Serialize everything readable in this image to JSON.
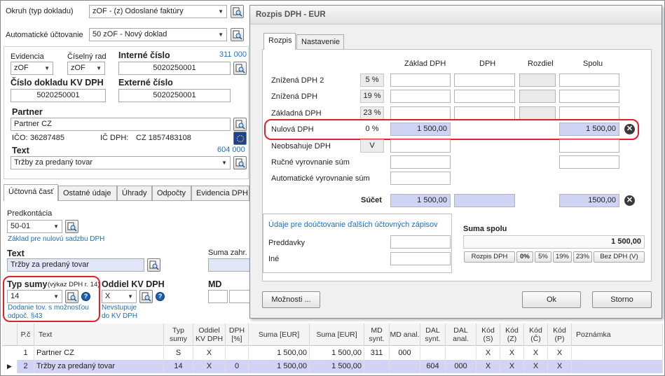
{
  "left": {
    "okruh": {
      "label": "Okruh (typ dokladu)",
      "value": "zOF - (z) Odoslané faktúry"
    },
    "auto": {
      "label": "Automatické účtovanie",
      "value": "50 zOF - Nový doklad"
    },
    "evidencia": {
      "label": "Evidencia",
      "value": "zOF"
    },
    "ciselny": {
      "label": "Číselný rad",
      "value": "zOF"
    },
    "interne": {
      "label": "Interné číslo",
      "value": "5020250001",
      "counter": "311 000"
    },
    "kvdph": {
      "label": "Číslo dokladu KV DPH",
      "value": "5020250001"
    },
    "externe": {
      "label": "Externé číslo",
      "value": "5020250001"
    },
    "partner": {
      "label": "Partner",
      "value": "Partner CZ",
      "ico_label": "IČO:",
      "ico": "36287485",
      "icdph_label": "IČ DPH:",
      "icdph": "CZ 1857483108"
    },
    "text": {
      "label": "Text",
      "value": "Tržby za predaný tovar",
      "counter": "604 000"
    },
    "tabs": [
      "Účtovná časť",
      "Ostatné údaje",
      "Úhrady",
      "Odpočty",
      "Evidencia DPH"
    ],
    "predkontacia": {
      "label": "Predkontácia",
      "value": "50-01",
      "hint": "Základ pre nulovú sadzbu DPH"
    },
    "text2": {
      "label": "Text",
      "value": "Tržby za predaný tovar"
    },
    "suma_zahr": "Suma zahr.",
    "typ_sumy": {
      "label": "Typ sumy",
      "sub": "(výkaz DPH r. 14)",
      "value": "14",
      "hint1": "Dodanie tov. s možnosťou",
      "hint2": "odpoč. §43"
    },
    "oddiel": {
      "label": "Oddiel KV DPH",
      "value": "X",
      "hint1": "Nevstupuje",
      "hint2": "do KV DPH"
    },
    "md": "MD"
  },
  "dialog": {
    "title": "Rozpis DPH - EUR",
    "tabs": [
      "Rozpis",
      "Nastavenie"
    ],
    "headers": [
      "Základ DPH",
      "DPH",
      "Rozdiel",
      "Spolu"
    ],
    "rows": [
      {
        "label": "Znížená DPH 2",
        "pct": "5 %",
        "zaklad": "",
        "dph": "",
        "spolu": ""
      },
      {
        "label": "Znížená DPH",
        "pct": "19 %",
        "zaklad": "",
        "dph": "",
        "spolu": ""
      },
      {
        "label": "Základná DPH",
        "pct": "23 %",
        "zaklad": "",
        "dph": "",
        "spolu": ""
      },
      {
        "label": "Nulová DPH",
        "pct": "0 %",
        "zaklad": "1 500,00",
        "dph": "",
        "spolu": "1 500,00"
      },
      {
        "label": "Neobsahuje DPH",
        "pct": "V",
        "zaklad": "",
        "dph": "",
        "spolu": ""
      },
      {
        "label": "Ručné vyrovnanie súm",
        "pct": "",
        "zaklad": "",
        "dph": "",
        "spolu": ""
      },
      {
        "label": "Automatické vyrovnanie súm",
        "pct": "",
        "zaklad": "",
        "dph": "",
        "spolu": ""
      }
    ],
    "sucet": {
      "label": "Súčet",
      "zaklad": "1 500,00",
      "spolu": "1500,00"
    },
    "udaje": {
      "title": "Údaje pre doúčtovanie ďalších účtovných zápisov",
      "preddavky": "Preddavky",
      "ine": "Iné"
    },
    "suma_spolu": {
      "label": "Suma spolu",
      "value": "1 500,00"
    },
    "rate_buttons": [
      "Rozpis DPH",
      "0%",
      "5%",
      "19%",
      "23%",
      "Bez DPH (V)"
    ],
    "buttons": {
      "moznosti": "Možnosti ...",
      "ok": "Ok",
      "storno": "Storno"
    }
  },
  "grid": {
    "headers": [
      "P.č",
      "Text",
      "Typ sumy",
      "Oddiel KV DPH",
      "DPH [%]",
      "Suma [EUR]",
      "Suma [EUR]",
      "MD synt.",
      "MD anal.",
      "DAL synt.",
      "DAL anal.",
      "Kód (S)",
      "Kód (Z)",
      "Kód (Č)",
      "Kód (P)",
      "Poznámka"
    ],
    "rows": [
      [
        "1",
        "Partner CZ",
        "S",
        "X",
        "",
        "1 500,00",
        "1 500,00",
        "311",
        "000",
        "",
        "",
        "X",
        "X",
        "X",
        "X",
        ""
      ],
      [
        "2",
        "Tržby za predaný tovar",
        "14",
        "X",
        "0",
        "1 500,00",
        "1 500,00",
        "",
        "",
        "604",
        "000",
        "X",
        "X",
        "X",
        "X",
        ""
      ]
    ]
  }
}
